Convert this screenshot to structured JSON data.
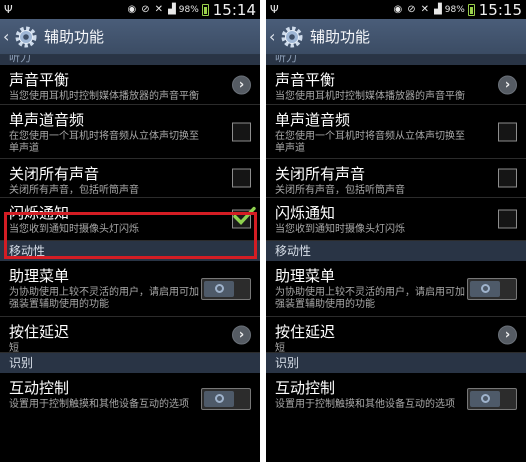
{
  "screens": [
    {
      "status": {
        "battery_percent": "98%",
        "time": "15:14"
      },
      "title": "辅助功能",
      "cutoff_section": "听力",
      "items": {
        "sound_balance": {
          "title": "声音平衡",
          "subtitle": "当您使用耳机时控制媒体播放器的声音平衡"
        },
        "mono_audio": {
          "title": "单声道音频",
          "subtitle": "在您使用一个耳机时将音频从立体声切换至单声道",
          "checked": false
        },
        "mute_all": {
          "title": "关闭所有声音",
          "subtitle": "关闭所有声音，包括听筒声音",
          "checked": false
        },
        "flash_notification": {
          "title": "闪烁通知",
          "subtitle": "当您收到通知时摄像头灯闪烁",
          "checked": true
        },
        "assistant_menu": {
          "title": "助理菜单",
          "subtitle": "为协助使用上较不灵活的用户，请启用可加强装置辅助使用的功能",
          "on": false
        },
        "press_delay": {
          "title": "按住延迟",
          "subtitle": "短"
        },
        "interaction_control": {
          "title": "互动控制",
          "subtitle": "设置用于控制触摸和其他设备互动的选项",
          "on": false
        }
      },
      "sections": {
        "mobility": "移动性",
        "recognition": "识别"
      }
    },
    {
      "status": {
        "battery_percent": "98%",
        "time": "15:15"
      },
      "title": "辅助功能",
      "cutoff_section": "听力",
      "items": {
        "sound_balance": {
          "title": "声音平衡",
          "subtitle": "当您使用耳机时控制媒体播放器的声音平衡"
        },
        "mono_audio": {
          "title": "单声道音频",
          "subtitle": "在您使用一个耳机时将音频从立体声切换至单声道",
          "checked": false
        },
        "mute_all": {
          "title": "关闭所有声音",
          "subtitle": "关闭所有声音，包括听筒声音",
          "checked": false
        },
        "flash_notification": {
          "title": "闪烁通知",
          "subtitle": "当您收到通知时摄像头灯闪烁",
          "checked": false
        },
        "assistant_menu": {
          "title": "助理菜单",
          "subtitle": "为协助使用上较不灵活的用户，请启用可加强装置辅助使用的功能",
          "on": false
        },
        "press_delay": {
          "title": "按住延迟",
          "subtitle": "短"
        },
        "interaction_control": {
          "title": "互动控制",
          "subtitle": "设置用于控制触摸和其他设备互动的选项",
          "on": false
        }
      },
      "sections": {
        "mobility": "移动性",
        "recognition": "识别"
      }
    }
  ],
  "colors": {
    "highlight_border": "#d41d24",
    "check_green": "#8fd14f",
    "section_bg": "#293445",
    "actionbar_bg": "#435570"
  },
  "icons": {
    "back": "chevron-left-icon",
    "settings": "gear-icon",
    "arrow": "chevron-right-icon"
  }
}
